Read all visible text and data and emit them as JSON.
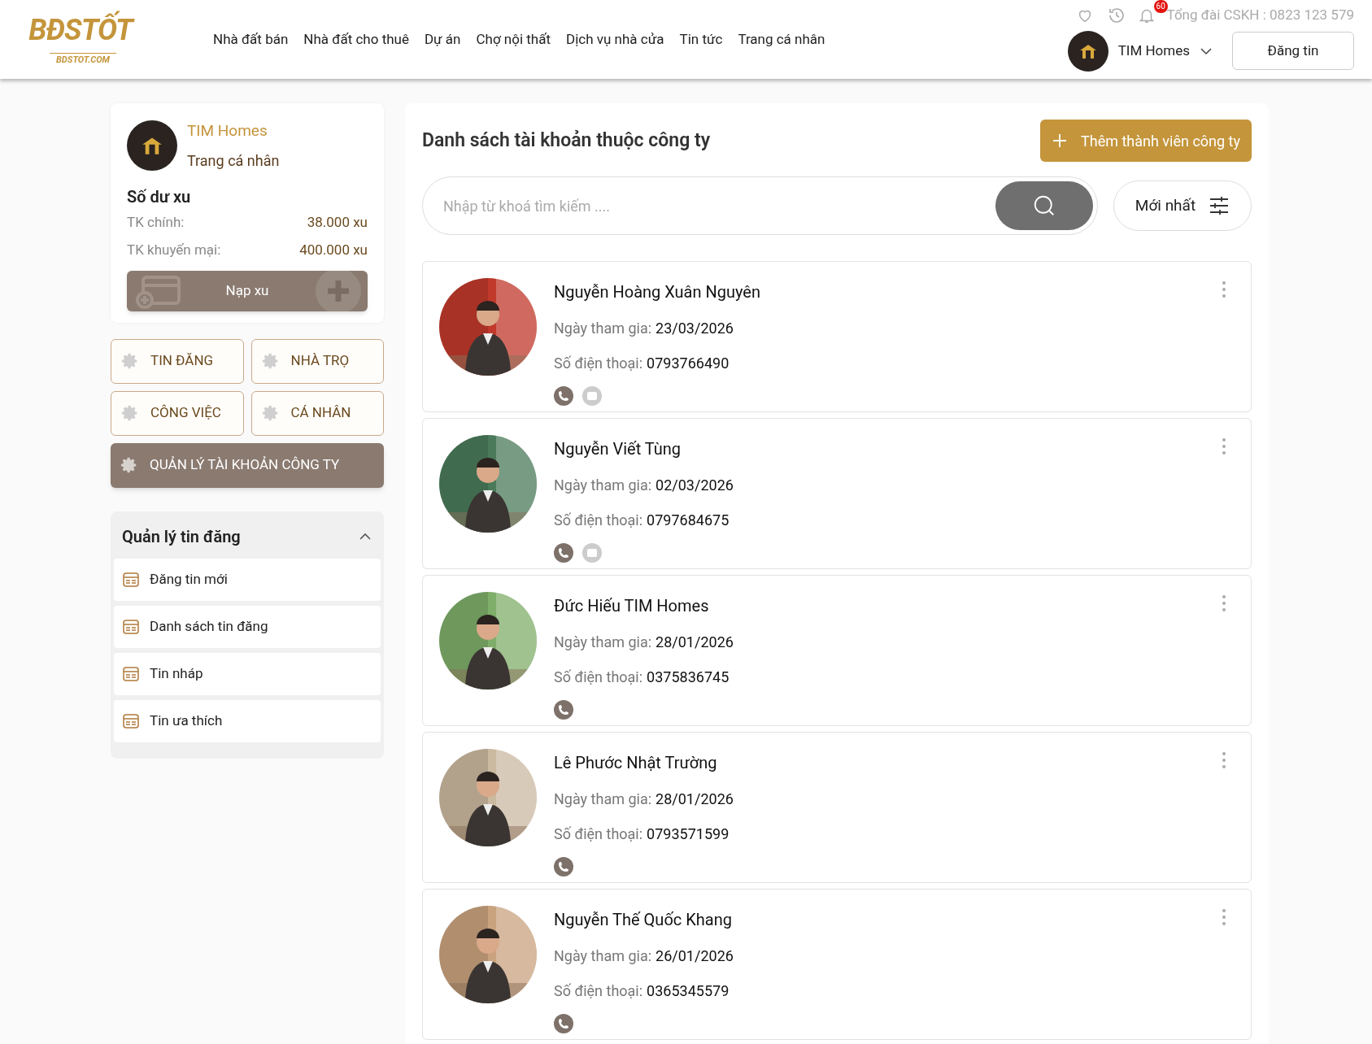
{
  "header": {
    "logo": {
      "brand": "BĐSTỐT",
      "domain": "BDSTOT.COM"
    },
    "nav": [
      "Nhà đất bán",
      "Nhà đất cho thuê",
      "Dự án",
      "Chợ nội thất",
      "Dịch vụ nhà cửa",
      "Tin tức",
      "Trang cá nhân"
    ],
    "notification_count": "60",
    "hotline": "Tổng đài CSKH : 0823 123 579",
    "user": {
      "name": "TIM Homes"
    },
    "post_button": "Đăng tin"
  },
  "profile": {
    "name": "TIM Homes",
    "link": "Trang cá nhân",
    "balance_title": "Số dư xu",
    "balances": [
      {
        "label": "TK chính:",
        "value": "38.000 xu"
      },
      {
        "label": "TK khuyến mại:",
        "value": "400.000 xu"
      }
    ],
    "topup_button": "Nạp xu"
  },
  "sections": [
    {
      "label": "TIN ĐĂNG",
      "selected": false
    },
    {
      "label": "NHÀ TRỌ",
      "selected": false
    },
    {
      "label": "CÔNG VIỆC",
      "selected": false
    },
    {
      "label": "CÁ NHÂN",
      "selected": false
    },
    {
      "label": "QUẢN LÝ TÀI KHOẢN CÔNG TY",
      "selected": true
    }
  ],
  "post_menu": {
    "title": "Quản lý tin đăng",
    "expanded": true,
    "items": [
      "Đăng tin mới",
      "Danh sách tin đăng",
      "Tin nháp",
      "Tin ưa thích"
    ]
  },
  "main": {
    "title": "Danh sách tài khoản thuộc công ty",
    "add_button": "Thêm thành viên công ty",
    "search": {
      "placeholder": "Nhập từ khoá tìm kiếm ...."
    },
    "sort": "Mới nhất",
    "members": [
      {
        "name": "Nguyễn Hoàng Xuân Nguyên",
        "join_label": "Ngày tham gia:",
        "join_date": "23/03/2026",
        "phone_label": "Số điện thoại:",
        "phone": "0793766490",
        "chat": true
      },
      {
        "name": "Nguyễn Viết Tùng",
        "join_label": "Ngày tham gia:",
        "join_date": "02/03/2026",
        "phone_label": "Số điện thoại:",
        "phone": "0797684675",
        "chat": true
      },
      {
        "name": "Đức Hiếu TIM Homes",
        "join_label": "Ngày tham gia:",
        "join_date": "28/01/2026",
        "phone_label": "Số điện thoại:",
        "phone": "0375836745",
        "chat": false
      },
      {
        "name": "Lê Phước Nhật Trường",
        "join_label": "Ngày tham gia:",
        "join_date": "28/01/2026",
        "phone_label": "Số điện thoại:",
        "phone": "0793571599",
        "chat": false
      },
      {
        "name": "Nguyễn Thế Quốc Khang",
        "join_label": "Ngày tham gia:",
        "join_date": "26/01/2026",
        "phone_label": "Số điện thoại:",
        "phone": "0365345579",
        "chat": false
      }
    ]
  }
}
